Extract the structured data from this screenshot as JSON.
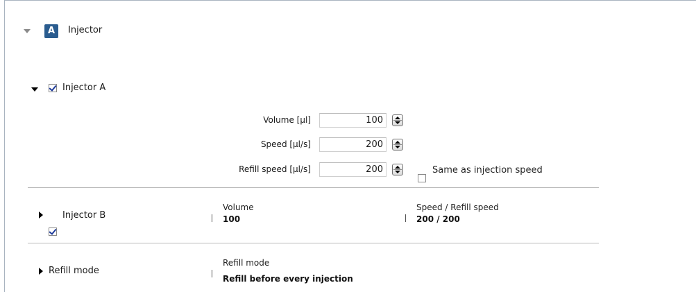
{
  "section": {
    "badge": "A",
    "title": "Injector"
  },
  "injector_a": {
    "label": "Injector A",
    "checked": true,
    "fields": [
      {
        "label": "Volume [µl]",
        "value": "100"
      },
      {
        "label": "Speed [µl/s]",
        "value": "200"
      },
      {
        "label": "Refill speed [µl/s]",
        "value": "200"
      }
    ],
    "same_as_label": "Same as injection speed"
  },
  "injector_b": {
    "label": "Injector B",
    "checked": true,
    "volume_label": "Volume",
    "volume_value": "100",
    "speed_label": "Speed / Refill speed",
    "speed_value": "200 / 200"
  },
  "refill": {
    "label": "Refill mode",
    "mode_label": "Refill mode",
    "mode_value": "Refill before every injection"
  }
}
